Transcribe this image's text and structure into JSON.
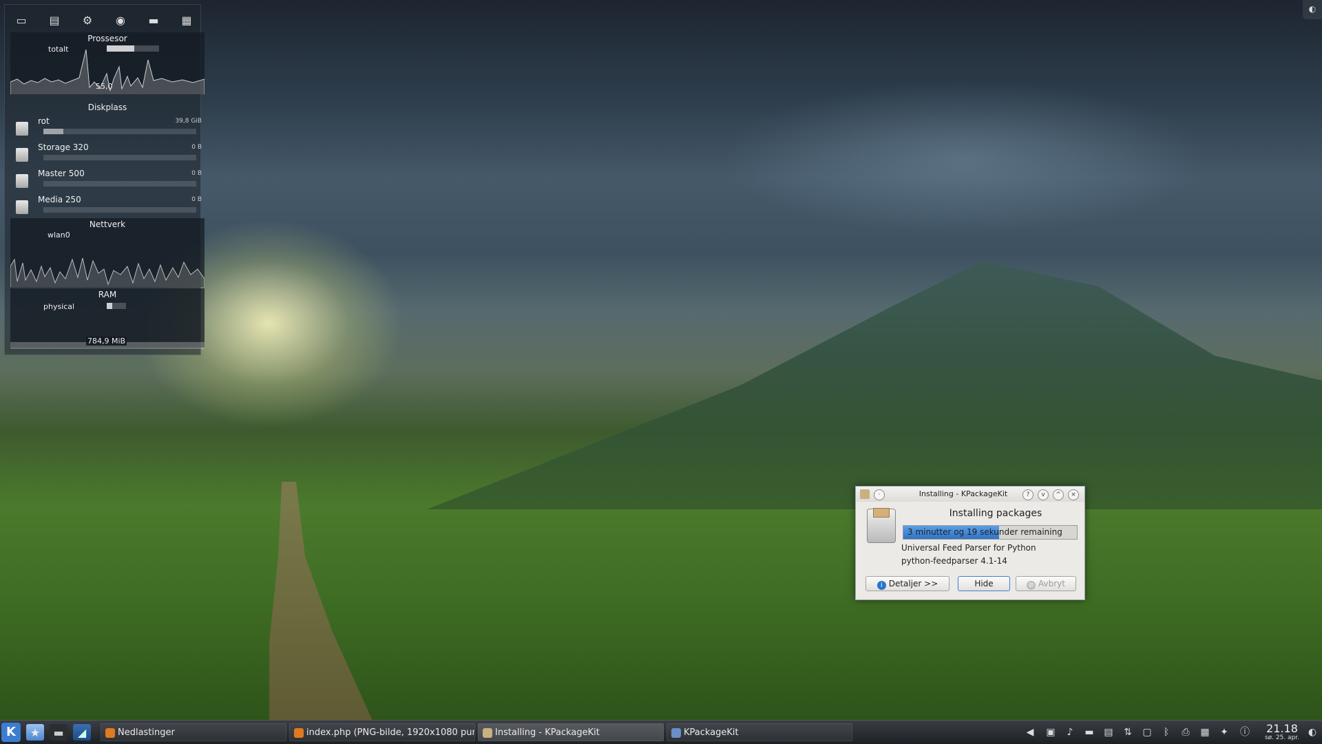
{
  "sysmon": {
    "processor": {
      "title": "Prossesor",
      "label": "totalt",
      "value": "55,0",
      "level": 0.52
    },
    "disk": {
      "title": "Diskplass",
      "items": [
        {
          "name": "rot",
          "value": "39,8 GiB",
          "level": 0.13
        },
        {
          "name": "Storage 320",
          "value": "0 B",
          "level": 0
        },
        {
          "name": "Master 500",
          "value": "0 B",
          "level": 0
        },
        {
          "name": "Media 250",
          "value": "0 B",
          "level": 0
        }
      ]
    },
    "network": {
      "title": "Nettverk",
      "label": "wlan0"
    },
    "ram": {
      "title": "RAM",
      "label": "physical",
      "value": "784,9 MiB",
      "level": 0.27
    }
  },
  "dialog": {
    "title": "Installing - KPackageKit",
    "heading": "Installing packages",
    "progress_text": "3 minutter og  19 sekunder remaining",
    "progress_level": 0.55,
    "package_desc": "Universal Feed Parser for Python",
    "package_name": "python-feedparser 4.1-14",
    "buttons": {
      "details": "Detaljer >>",
      "hide": "Hide",
      "cancel": "Avbryt"
    }
  },
  "taskbar": {
    "tasks": [
      {
        "label": "Nedlastinger"
      },
      {
        "label": "index.php (PNG-bilde, 1920x1080 pun"
      },
      {
        "label": "Installing - KPackageKit"
      },
      {
        "label": "KPackageKit"
      }
    ],
    "clock": {
      "time": "21.18",
      "date": "sø. 25. apr."
    }
  },
  "icons": [
    "kde-menu-icon",
    "folder-star-icon",
    "show-desktop-icon",
    "terminal-icon",
    "monitor-icon",
    "volume-icon",
    "battery-icon",
    "clipboard-icon",
    "network-icon",
    "bluetooth-icon",
    "printer-icon",
    "package-icon",
    "info-icon"
  ]
}
